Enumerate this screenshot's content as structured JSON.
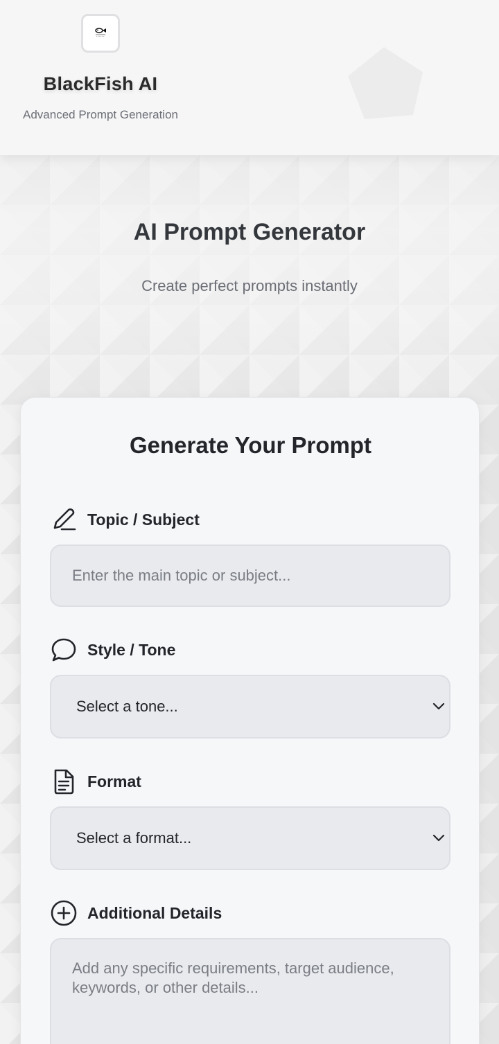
{
  "brand": {
    "name": "BlackFish AI",
    "tagline": "Advanced Prompt Generation"
  },
  "hero": {
    "title": "AI Prompt Generator",
    "subtitle": "Create perfect prompts instantly"
  },
  "card": {
    "title": "Generate Your Prompt",
    "fields": {
      "topic": {
        "label": "Topic / Subject",
        "icon": "pencil-icon",
        "placeholder": "Enter the main topic or subject..."
      },
      "tone": {
        "label": "Style / Tone",
        "icon": "speech-bubble-icon",
        "selected": "Select a tone..."
      },
      "format": {
        "label": "Format",
        "icon": "document-icon",
        "selected": "Select a format..."
      },
      "details": {
        "label": "Additional Details",
        "icon": "plus-circle-icon",
        "placeholder": "Add any specific requirements, target audience, keywords, or other details..."
      }
    }
  },
  "colors": {
    "header_bg": "#f6f6f7",
    "card_bg": "#f6f7f9",
    "input_bg": "#e8eaee",
    "text_dark": "#23252a",
    "text_muted": "#6b6e75"
  }
}
